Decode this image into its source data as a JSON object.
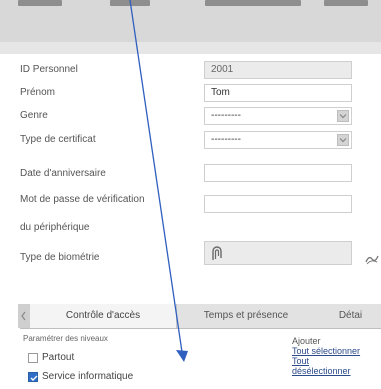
{
  "form": {
    "fields": [
      {
        "label": "ID Personnel",
        "value": "2001",
        "type": "readonly"
      },
      {
        "label": "Prénom",
        "value": "Tom",
        "type": "text"
      },
      {
        "label": "Genre",
        "value": "---------",
        "type": "select"
      },
      {
        "label": "Type de certificat",
        "value": "---------",
        "type": "select"
      },
      {
        "label": "Date d'anniversaire",
        "value": "",
        "type": "text"
      },
      {
        "label": "Mot de passe de vérification",
        "label2": "du périphérique",
        "value": "",
        "type": "text"
      },
      {
        "label": "Type de biométrie",
        "value": "",
        "type": "biometric"
      }
    ]
  },
  "tabs": [
    {
      "label": "Contrôle d'accès",
      "active": true
    },
    {
      "label": "Temps et présence",
      "active": false
    },
    {
      "label": "Détai",
      "active": false
    }
  ],
  "access": {
    "section_title": "Paramétrer des niveaux",
    "options": [
      {
        "label": "Partout",
        "checked": false
      },
      {
        "label": "Service informatique",
        "checked": true
      }
    ],
    "links_title": "Ajouter",
    "links": [
      "Tout sélectionner",
      "Tout",
      "désélectionner"
    ]
  },
  "icons": {
    "dropdown": "dropdown-caret-icon",
    "fingerprint": "fingerprint-icon",
    "biometric_side": "biometric-device-icon"
  },
  "colors": {
    "accent": "#2f6fc6",
    "annotation_arrow": "#2f5fbf"
  }
}
